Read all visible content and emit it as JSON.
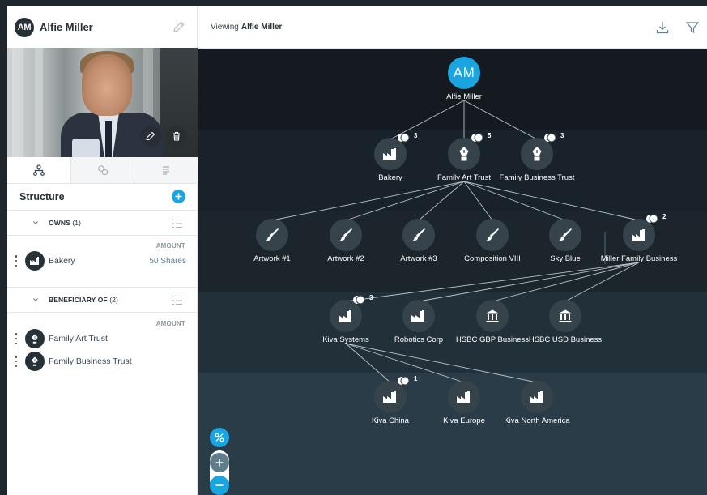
{
  "sidebar": {
    "avatar_initials": "AM",
    "profile_name": "Alfie Miller",
    "structure_title": "Structure",
    "owns": {
      "label": "OWNS",
      "count": "(1)",
      "amount_header": "AMOUNT",
      "items": [
        {
          "name": "Bakery",
          "amount": "50 Shares"
        }
      ]
    },
    "beneficiary": {
      "label": "BENEFICIARY OF",
      "count": "(2)",
      "amount_header": "AMOUNT",
      "items": [
        {
          "name": "Family Art Trust"
        },
        {
          "name": "Family Business Trust"
        }
      ]
    }
  },
  "topbar": {
    "viewing_prefix": "Viewing",
    "viewing_name": "Alfie Miller"
  },
  "graph": {
    "root": {
      "initials": "AM",
      "label": "Alfie Miller"
    },
    "level1": [
      {
        "label": "Bakery",
        "badge": "3",
        "icon": "factory-icon"
      },
      {
        "label": "Family Art Trust",
        "badge": "5",
        "icon": "trust-pen-icon"
      },
      {
        "label": "Family Business Trust",
        "badge": "3",
        "icon": "trust-pen-icon"
      }
    ],
    "level2": [
      {
        "label": "Artwork #1",
        "icon": "brush-icon"
      },
      {
        "label": "Artwork #2",
        "icon": "brush-icon"
      },
      {
        "label": "Artwork #3",
        "icon": "brush-icon"
      },
      {
        "label": "Composition VIII",
        "icon": "brush-icon"
      },
      {
        "label": "Sky Blue",
        "icon": "brush-icon"
      },
      {
        "label": "Miller Family Business",
        "badge": "2",
        "icon": "factory-icon"
      }
    ],
    "level3": [
      {
        "label": "Kiva Systems",
        "badge": "3",
        "icon": "factory-icon"
      },
      {
        "label": "Robotics Corp",
        "icon": "factory-icon"
      },
      {
        "label": "HSBC GBP Business",
        "icon": "bank-icon"
      },
      {
        "label": "HSBC USD Business",
        "icon": "bank-icon"
      }
    ],
    "level4": [
      {
        "label": "Kiva China",
        "badge": "1",
        "icon": "factory-icon"
      },
      {
        "label": "Kiva Europe",
        "icon": "factory-icon"
      },
      {
        "label": "Kiva North America",
        "icon": "factory-icon"
      }
    ]
  },
  "colors": {
    "accent": "#1aa5e0",
    "band_dark": "#141a1f",
    "band_mid": "#1c252c",
    "band_light": "#2a3c47",
    "node": "#37434a"
  }
}
